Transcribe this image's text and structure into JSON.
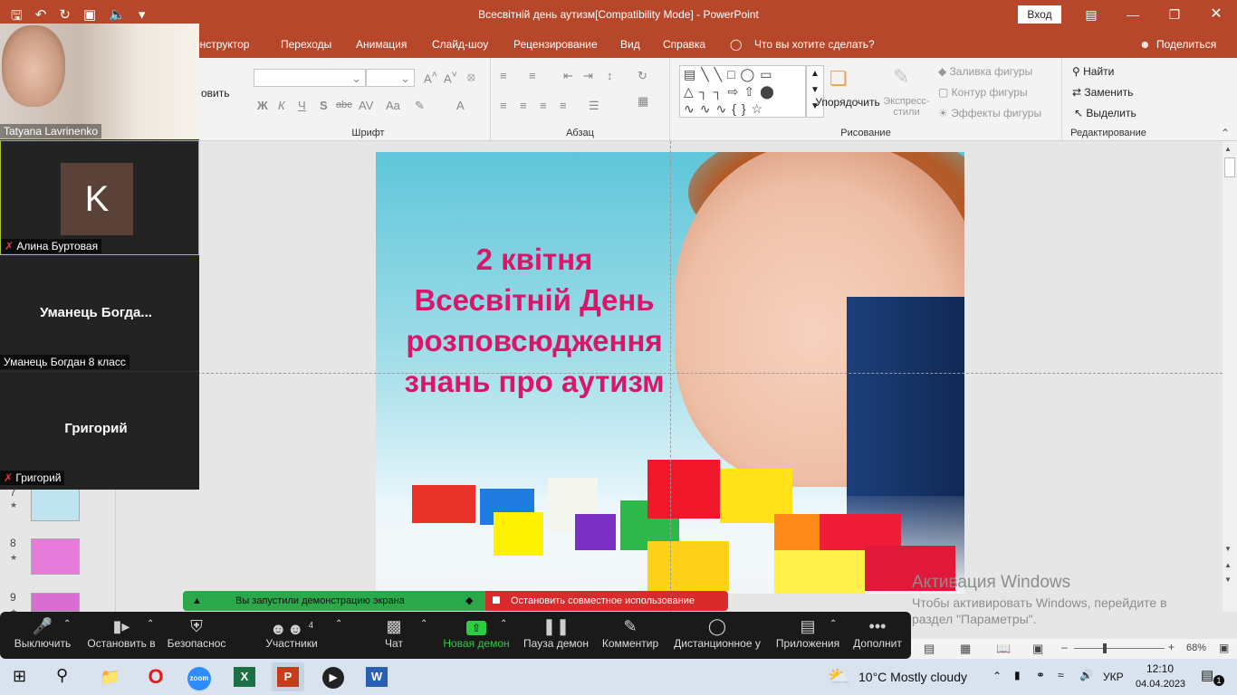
{
  "window": {
    "title": "Всесвітній день аутизм[Compatibility Mode]  -  PowerPoint",
    "signin": "Вход"
  },
  "ribbon_tabs": [
    "онструктор",
    "Переходы",
    "Анимация",
    "Слайд-шоу",
    "Рецензирование",
    "Вид",
    "Справка",
    "Что вы хотите сделать?"
  ],
  "share_label": "Поделиться",
  "ribbon": {
    "left_partial": "овить",
    "font_group": "Шрифт",
    "para_group": "Абзац",
    "draw_group": "Рисование",
    "edit_group": "Редактирование",
    "arrange": "Упорядочить",
    "express_styles": "Экспресс-стили",
    "fill": "Заливка фигуры",
    "outline": "Контур фигуры",
    "effects": "Эффекты фигуры",
    "find": "Найти",
    "replace": "Заменить",
    "select": "Выделить",
    "bold": "Ж",
    "italic": "К",
    "underline": "Ч",
    "shadow": "S",
    "strike": "abc",
    "spacing": "AV",
    "case": "Aa",
    "color": "A"
  },
  "slide": {
    "lines": [
      "2 квітня",
      "Всесвітній День",
      "розповсюдження",
      "знань про аутизм"
    ]
  },
  "thumbnails": [
    {
      "num": "7"
    },
    {
      "num": "8"
    },
    {
      "num": "9"
    }
  ],
  "participants": [
    {
      "name": "Tatyana Lavrinenko"
    },
    {
      "name": "Алина Буртовая",
      "avatar_letter": "K"
    },
    {
      "display": "Уманець  Богда...",
      "name": "Уманець Богдан 8 класс"
    },
    {
      "display": "Григорий",
      "name": "Григорий"
    }
  ],
  "share_notice": {
    "started": "Вы запустили демонстрацию экрана",
    "stop": "Остановить совместное использование"
  },
  "zoom_toolbar": [
    {
      "label": "Выключить",
      "icon": "microphone-icon"
    },
    {
      "label": "Остановить в",
      "icon": "video-camera-icon"
    },
    {
      "label": "Безопаснос",
      "icon": "shield-icon"
    },
    {
      "label": "Участники",
      "icon": "participants-icon",
      "count": "4"
    },
    {
      "label": "Чат",
      "icon": "chat-icon"
    },
    {
      "label": "Новая демон",
      "icon": "share-screen-icon"
    },
    {
      "label": "Пауза демон",
      "icon": "pause-icon"
    },
    {
      "label": "Комментир",
      "icon": "pencil-icon"
    },
    {
      "label": "Дистанционное у",
      "icon": "mouse-icon"
    },
    {
      "label": "Приложения",
      "icon": "apps-icon"
    },
    {
      "label": "Дополнит",
      "icon": "more-icon"
    }
  ],
  "watermark": {
    "title": "Активация Windows",
    "line1": "Чтобы активировать Windows, перейдите в",
    "line2": "раздел \"Параметры\"."
  },
  "status": {
    "zoom": "68%"
  },
  "taskbar": {
    "weather": "10°C  Mostly cloudy",
    "lang": "УКР",
    "time": "12:10",
    "date": "04.04.2023",
    "notifications": "1"
  },
  "colors": {
    "accent": "#b7472a",
    "slide_title": "#d9176a",
    "share_green": "#1e9e3c",
    "share_red": "#d92b2b"
  }
}
